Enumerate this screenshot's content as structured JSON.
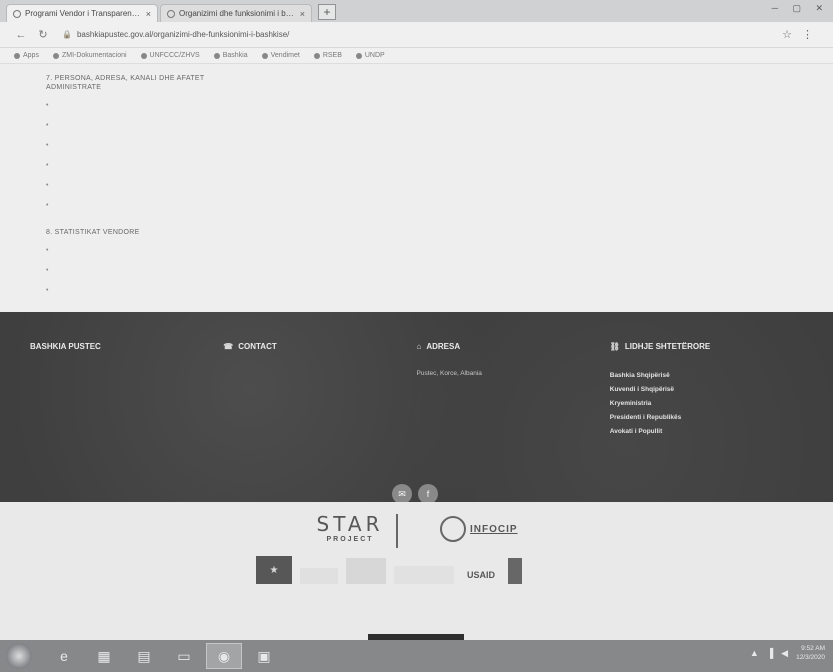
{
  "browser": {
    "tabs": [
      {
        "title": "Programi Vendor i Transparencës",
        "close": "×"
      },
      {
        "title": "Organizimi dhe funksionimi i bashkis",
        "close": "×"
      }
    ],
    "new_tab": "+",
    "window_controls": "─ ▢ ✕",
    "url": "bashkiapustec.gov.al/organizimi-dhe-funksionimi-i-bashkise/",
    "bookmarks": [
      "Apps",
      "ZMI-Dokumentacioni",
      "UNFCCC/ZHVS",
      "Bashkia",
      "Vendimet",
      "RSEB",
      "UNDP"
    ]
  },
  "content": {
    "section1_title": "7. PERSONA, ADRESA, KANALI DHE AFATET",
    "section1_subtitle": "ADMINISTRATE",
    "section1_bullets": [
      "",
      "",
      "",
      "",
      "",
      ""
    ],
    "section2_title": "8. STATISTIKAT VENDORE",
    "section2_bullets": [
      "",
      "",
      ""
    ]
  },
  "footer": {
    "col1": {
      "title": "BASHKIA PUSTEC",
      "text": ""
    },
    "col2": {
      "title": "CONTACT",
      "email": "",
      "phone": ""
    },
    "col3": {
      "title": "ADRESA",
      "address": "Pustec, Korce, Albania"
    },
    "col4": {
      "title": "LIDHJE SHTETËRORE",
      "links": [
        "Bashkia Shqipërisë",
        "Kuvendi i Shqipërisë",
        "Kryeministria",
        "Presidenti i Republikës",
        "Avokati i Popullit"
      ]
    }
  },
  "partners": {
    "star_main": "STAR",
    "star_sub": "PROJECT",
    "infocip": "INFOCIP",
    "eu": "★",
    "usaid": "USAID",
    "disclaimer": ""
  },
  "taskbar": {
    "time": "9:52 AM",
    "date": "12/3/2020"
  }
}
